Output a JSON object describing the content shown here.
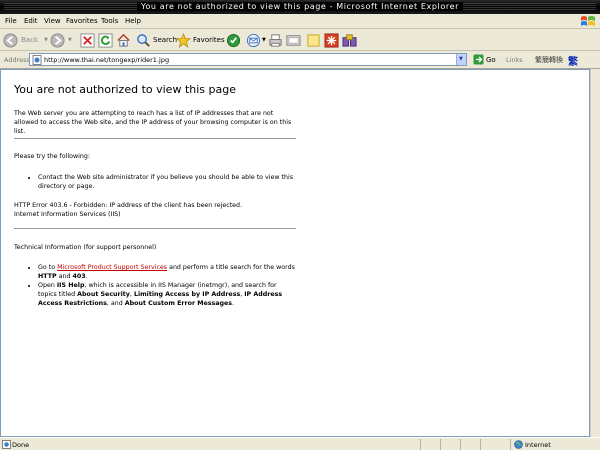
{
  "window": {
    "title": "You are not authorized to view this page - Microsoft Internet Explorer"
  },
  "menu": {
    "items": [
      "File",
      "Edit",
      "View",
      "Favorites",
      "Tools",
      "Help"
    ]
  },
  "toolbar": {
    "back_label": "Back",
    "search_label": "Search",
    "favorites_label": "Favorites"
  },
  "address": {
    "label": "Address",
    "url": "http://www.thai.net/tongexp/rider1.jpg",
    "go_label": "Go",
    "links_label": "Links",
    "cjk_label": "繁簡轉換",
    "fan_label": "繁"
  },
  "page": {
    "heading": "You are not authorized to view this page",
    "intro": "The Web server you are attempting to reach has a list of IP addresses that are not allowed to access the Web site, and the IP address of your browsing computer is on this list.",
    "try_label": "Please try the following:",
    "bullet1": "Contact the Web site administrator if you believe you should be able to view this directory or page.",
    "error_line1": "HTTP Error 403.6 - Forbidden: IP address of the client has been rejected.",
    "error_line2": "Internet Information Services (IIS)",
    "tech_label": "Technical Information (for support personnel)",
    "tech1_pre": "Go to ",
    "tech1_link": "Microsoft Product Support Services",
    "tech1_mid": " and perform a title search for the words ",
    "tech1_http": "HTTP",
    "tech1_and": " and ",
    "tech1_403": "403",
    "tech1_end": ".",
    "tech2_pre": "Open ",
    "tech2_iis": "IIS Help",
    "tech2_mid": ", which is accessible in IIS Manager (inetmgr), and search for topics titled ",
    "tech2_t1": "About Security",
    "tech2_c1": ", ",
    "tech2_t2": "Limiting Access by IP Address",
    "tech2_c2": ", ",
    "tech2_t3": "IP Address Access Restrictions",
    "tech2_and": ", and ",
    "tech2_t4": "About Custom Error Messages",
    "tech2_end": "."
  },
  "status": {
    "text": "Done",
    "zone": "Internet"
  },
  "colors": {
    "link": "#c00000",
    "titlebar": "#000000"
  }
}
